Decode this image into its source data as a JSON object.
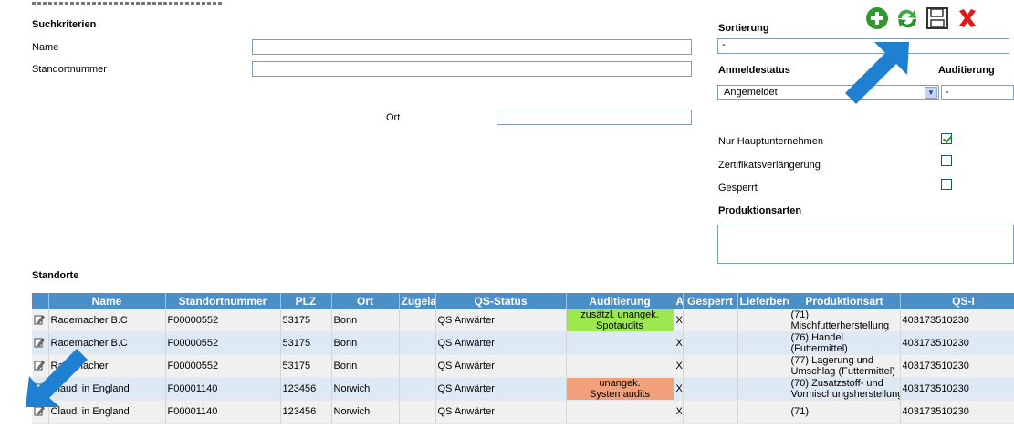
{
  "search": {
    "heading": "Suchkriterien",
    "name_label": "Name",
    "name_value": "",
    "standortnummer_label": "Standortnummer",
    "standortnummer_value": "",
    "ort_label": "Ort",
    "ort_value": ""
  },
  "right_panel": {
    "sortierung_label": "Sortierung",
    "sortierung_value": "-",
    "anmeldestatus_label": "Anmeldestatus",
    "anmeldestatus_value": "Angemeldet",
    "auditierung_label": "Auditierung",
    "auditierung_value": "-",
    "nur_hauptunternehmen_label": "Nur Hauptunternehmen",
    "nur_hauptunternehmen_checked": true,
    "zertifikatsverlaengerung_label": "Zertifikatsverlängerung",
    "zertifikatsverlaengerung_checked": false,
    "gesperrt_label": "Gesperrt",
    "gesperrt_checked": false,
    "produktionsarten_label": "Produktionsarten"
  },
  "toolbar": {
    "icons": [
      "add-icon",
      "refresh-icon",
      "save-icon",
      "delete-icon"
    ],
    "colors": {
      "add": "#2e9a2e",
      "refresh": "#3aa83a",
      "delete": "#e01818"
    }
  },
  "table": {
    "heading": "Standorte",
    "columns": [
      "",
      "Name",
      "Standortnummer",
      "PLZ",
      "Ort",
      "Zugela",
      "QS-Status",
      "Auditierung",
      "A",
      "Gesperrt",
      "Lieferbere",
      "Produktionsart",
      "QS-I"
    ],
    "rows": [
      {
        "name": "Rademacher B.C",
        "standortnummer": "F00000552",
        "plz": "53175",
        "ort": "Bonn",
        "zugela": "",
        "qs_status": "QS Anwärter",
        "auditierung": "zusätzl. unangek. Spotaudits",
        "a": "X",
        "gesperrt": "",
        "lieferbere": "",
        "produktionsart": "(71) Mischfutterherstellung",
        "qs_id": "403173510230"
      },
      {
        "name": "Rademacher B.C",
        "standortnummer": "F00000552",
        "plz": "53175",
        "ort": "Bonn",
        "zugela": "",
        "qs_status": "QS Anwärter",
        "auditierung": "",
        "a": "X",
        "gesperrt": "",
        "lieferbere": "",
        "produktionsart": "(76) Handel (Futtermittel)",
        "qs_id": "403173510230"
      },
      {
        "name": "Rademacher",
        "standortnummer": "F00000552",
        "plz": "53175",
        "ort": "Bonn",
        "zugela": "",
        "qs_status": "QS Anwärter",
        "auditierung": "",
        "a": "X",
        "gesperrt": "",
        "lieferbere": "",
        "produktionsart": "(77) Lagerung und Umschlag (Futtermittel)",
        "qs_id": "403173510230"
      },
      {
        "name": "Claudi in England",
        "standortnummer": "F00001140",
        "plz": "123456",
        "ort": "Norwich",
        "zugela": "",
        "qs_status": "QS Anwärter",
        "auditierung": "unangek. Systemaudits",
        "a": "X",
        "gesperrt": "",
        "lieferbere": "",
        "produktionsart": "(70) Zusatzstoff- und Vormischungsherstellung",
        "qs_id": "403173510230"
      },
      {
        "name": "Claudi in England",
        "standortnummer": "F00001140",
        "plz": "123456",
        "ort": "Norwich",
        "zugela": "",
        "qs_status": "QS Anwärter",
        "auditierung": "",
        "a": "X",
        "gesperrt": "",
        "lieferbere": "",
        "produktionsart": "(71)",
        "qs_id": "403173510230"
      }
    ]
  },
  "accent_colors": {
    "header_blue": "#4a8fc7",
    "row_blue": "#dde9f5",
    "green_badge": "#9ee84f",
    "salmon_badge": "#f2a07b",
    "arrow_blue": "#1f7fd1"
  }
}
